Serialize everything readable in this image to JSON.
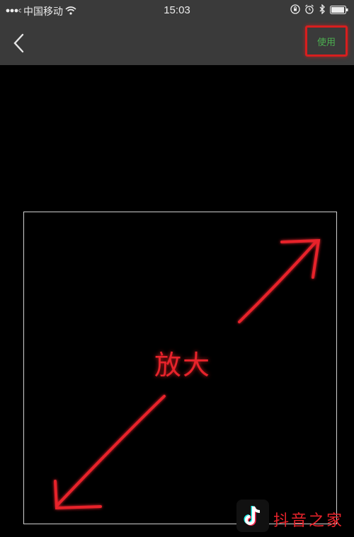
{
  "status_bar": {
    "carrier": "中国移动",
    "time": "15:03"
  },
  "nav": {
    "use_label": "使用"
  },
  "annotation": {
    "zoom_label": "放大",
    "color": "#e8232b"
  },
  "watermark": {
    "text": "抖音之家"
  },
  "colors": {
    "bar_bg": "#3a3a3a",
    "use_text": "#4caf50",
    "highlight_border": "#d81e1e"
  }
}
